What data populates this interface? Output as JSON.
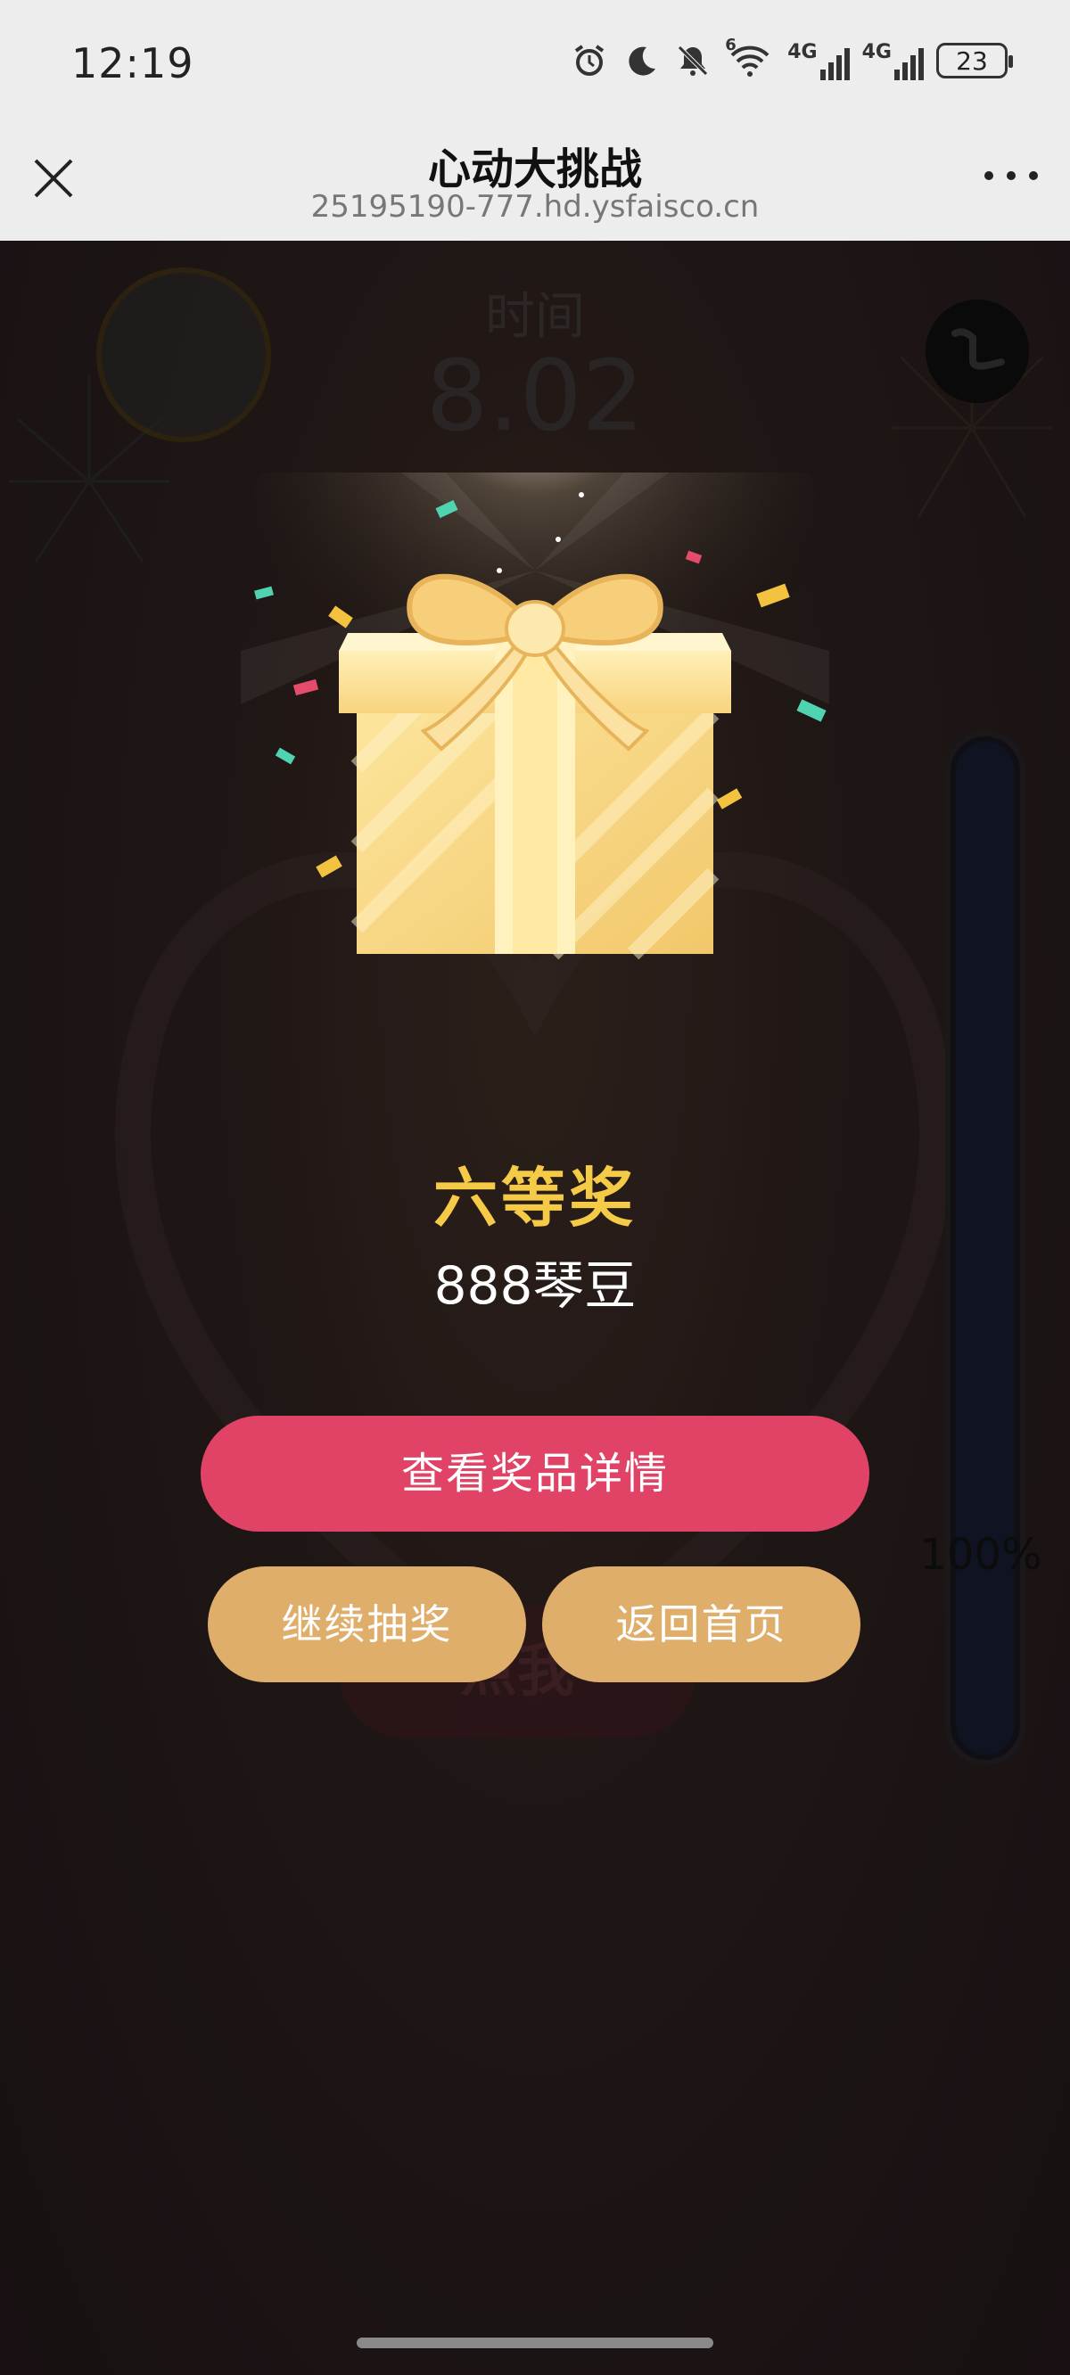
{
  "status_bar": {
    "time": "12:19",
    "signal_1_label": "4G",
    "signal_2_label": "4G",
    "wifi_label": "6",
    "battery": "23",
    "icons": [
      "alarm-icon",
      "moon-icon",
      "mute-icon",
      "wifi-icon",
      "signal-icon",
      "signal-icon",
      "battery-icon"
    ]
  },
  "header": {
    "title": "心动大挑战",
    "subtitle": "25195190-777.hd.ysfaisco.cn"
  },
  "game": {
    "timer_label": "时间",
    "timer_value": "8.02",
    "ghost_button": "点我",
    "progress_label": "100%",
    "progress_value": 1.0
  },
  "prize": {
    "level": "六等奖",
    "name": "888琴豆"
  },
  "actions": {
    "view_details": "查看奖品详情",
    "continue": "继续抽奖",
    "home": "返回首页"
  },
  "colors": {
    "primary_button": "#e04366",
    "secondary_button": "#dfae6b",
    "prize_level": "#f4ca46"
  }
}
